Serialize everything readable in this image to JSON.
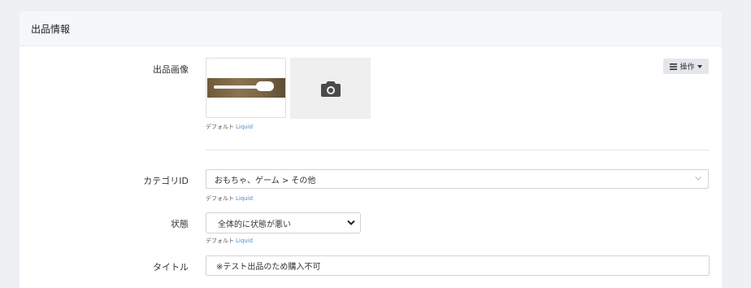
{
  "section": {
    "title": "出品情報"
  },
  "image_field": {
    "label": "出品画像",
    "default_label": "デフォルト",
    "liquid_label": "Liquid"
  },
  "operations": {
    "label": "操作",
    "icon": "list-icon"
  },
  "category": {
    "label": "カテゴリID",
    "value": "おもちゃ、ゲーム > その他",
    "default_label": "デフォルト",
    "liquid_label": "Liquid"
  },
  "condition": {
    "label": "状態",
    "value": "全体的に状態が悪い",
    "default_label": "デフォルト",
    "liquid_label": "Liquid"
  },
  "title_field": {
    "label": "タイトル",
    "value": "※テスト出品のため購入不可"
  }
}
